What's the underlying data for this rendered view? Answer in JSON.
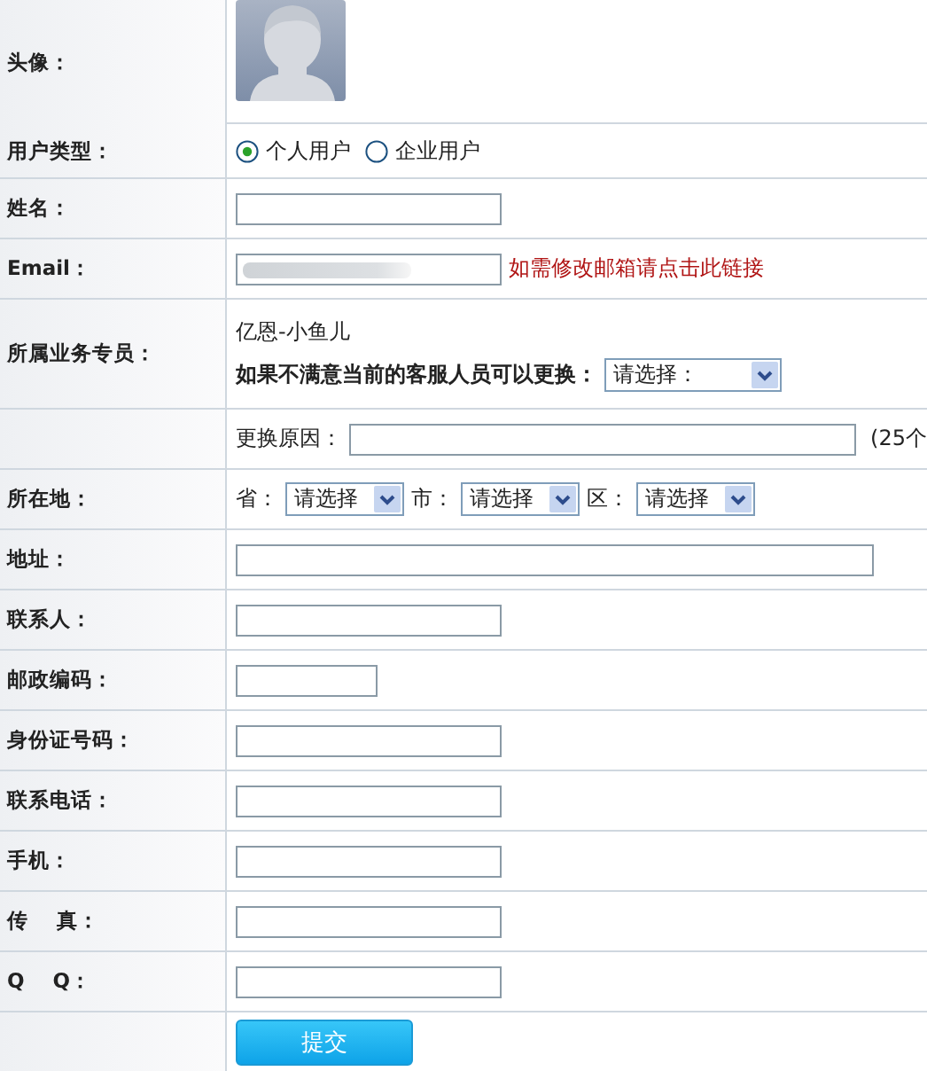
{
  "rows": [
    {
      "kind": "avatar",
      "label": "头像："
    },
    {
      "kind": "radio",
      "label": "用户类型：",
      "options": [
        {
          "label": "个人用户",
          "selected": true
        },
        {
          "label": "企业用户",
          "selected": false
        }
      ]
    },
    {
      "kind": "input",
      "label": "姓名："
    },
    {
      "kind": "email",
      "label": "Email：",
      "link": "如需修改邮箱请点击此链接"
    },
    {
      "kind": "agent",
      "label": "所属业务专员：",
      "agent": "亿恩-小鱼儿",
      "prompt": "如果不满意当前的客服人员可以更换：",
      "dropdown": "请选择："
    },
    {
      "kind": "reason",
      "field_label": "更换原因：",
      "note": "(25个"
    },
    {
      "kind": "location",
      "label": "所在地：",
      "selects": [
        {
          "label": "省：",
          "value": "请选择"
        },
        {
          "label": "市：",
          "value": "请选择"
        },
        {
          "label": "区：",
          "value": "请选择"
        }
      ]
    },
    {
      "kind": "wide",
      "label": "地址："
    },
    {
      "kind": "input",
      "label": "联系人："
    },
    {
      "kind": "short",
      "label": "邮政编码："
    },
    {
      "kind": "input",
      "label": "身份证号码："
    },
    {
      "kind": "input",
      "label": "联系电话："
    },
    {
      "kind": "input",
      "label": "手机："
    },
    {
      "kind": "input",
      "label": "传    真："
    },
    {
      "kind": "input",
      "label": "Q    Q："
    },
    {
      "kind": "submit",
      "button": "提交"
    }
  ]
}
